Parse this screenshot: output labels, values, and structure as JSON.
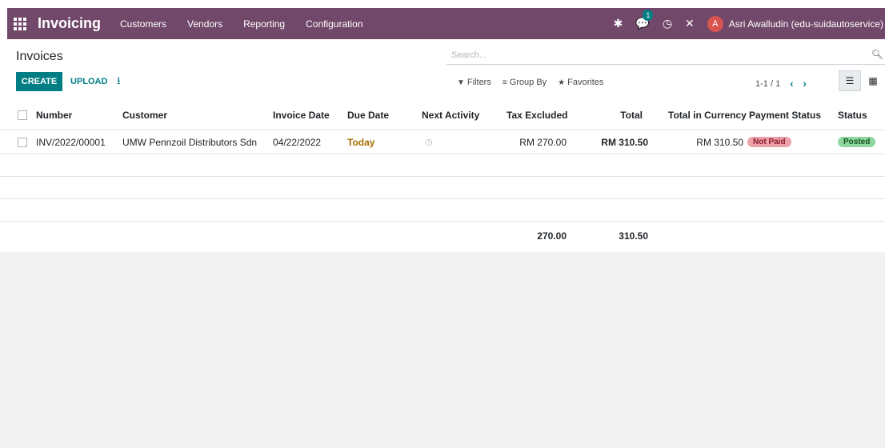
{
  "topbar": {
    "app_title": "Invoicing",
    "menu": [
      "Customers",
      "Vendors",
      "Reporting",
      "Configuration"
    ],
    "messages_badge": "1",
    "user_initial": "A",
    "user_name": "Asri Awalludin (edu-suidautoservice)",
    "icons": [
      "apps-icon",
      "debug-icon",
      "chat-icon",
      "clock-icon",
      "tools-icon"
    ],
    "bg_color": "#71486a"
  },
  "control_panel": {
    "breadcrumb": "Invoices",
    "search_placeholder": "Search...",
    "create_label": "CREATE",
    "upload_label": "UPLOAD",
    "filters_label": "Filters",
    "group_by_label": "Group By",
    "favorites_label": "Favorites",
    "pager": "1-1 / 1"
  },
  "table": {
    "headers": [
      "Number",
      "Customer",
      "Invoice Date",
      "Due Date",
      "Next Activity",
      "Tax Excluded",
      "Total",
      "Total in Currency",
      "Payment Status",
      "Status"
    ],
    "rows": [
      {
        "number": "INV/2022/00001",
        "customer": "UMW Pennzoil Distributors Sdn",
        "invoice_date": "04/22/2022",
        "due_date": "Today",
        "tax_excluded": "RM 270.00",
        "total": "RM 310.50",
        "total_currency": "RM 310.50",
        "payment_status": "Not Paid",
        "status": "Posted"
      }
    ],
    "footer": {
      "tax_excluded": "270.00",
      "total": "310.50"
    }
  },
  "colors": {
    "accent": "#017e84",
    "due_warning": "#a86f00",
    "not_paid": "#eba2a8",
    "posted": "#8fd6a1"
  }
}
